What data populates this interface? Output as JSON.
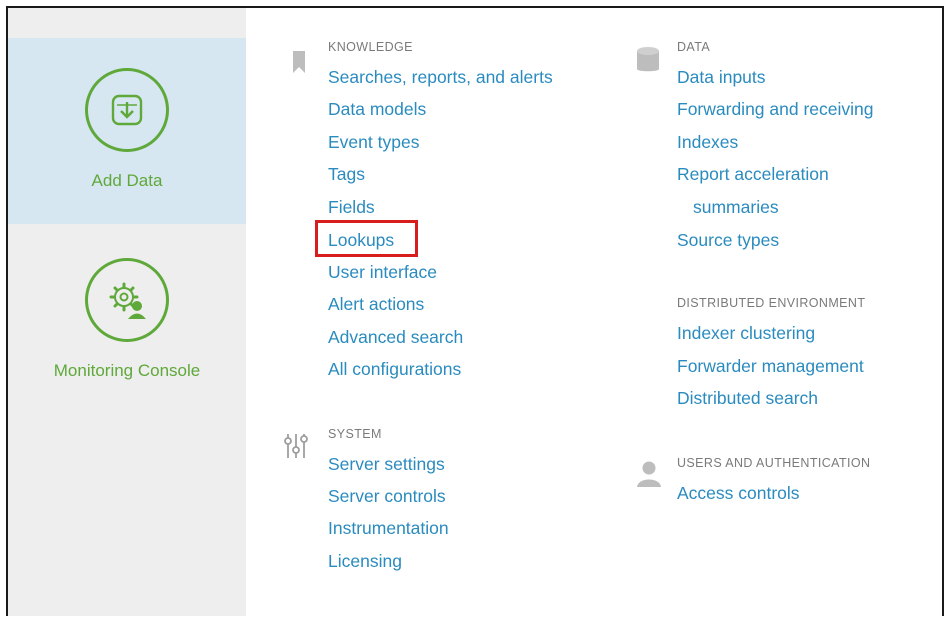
{
  "apps": [
    {
      "label": "Add Data",
      "icon": "download-icon",
      "selected": true
    },
    {
      "label": "Monitoring Console",
      "icon": "gear-user-icon",
      "selected": false
    }
  ],
  "knowledge": {
    "title": "KNOWLEDGE",
    "icon": "bookmark-icon",
    "links": [
      "Searches, reports, and alerts",
      "Data models",
      "Event types",
      "Tags",
      "Fields",
      "Lookups",
      "User interface",
      "Alert actions",
      "Advanced search",
      "All configurations"
    ]
  },
  "system": {
    "title": "SYSTEM",
    "icon": "sliders-icon",
    "links": [
      "Server settings",
      "Server controls",
      "Instrumentation",
      "Licensing"
    ]
  },
  "data": {
    "title": "DATA",
    "icon": "database-icon",
    "links": [
      "Data inputs",
      "Forwarding and receiving",
      "Indexes",
      "Report acceleration",
      "summaries",
      "Source types"
    ]
  },
  "distributed": {
    "title": "DISTRIBUTED ENVIRONMENT",
    "links": [
      "Indexer clustering",
      "Forwarder management",
      "Distributed search"
    ]
  },
  "users": {
    "title": "USERS AND AUTHENTICATION",
    "icon": "user-icon",
    "links": [
      "Access controls"
    ]
  },
  "highlighted_link": "Lookups",
  "colors": {
    "link": "#2a8bbf",
    "app_green": "#5fa83a",
    "highlight": "#d81d1d",
    "selected_tile": "#d7e7f2",
    "sidebar": "#eeeeee"
  }
}
